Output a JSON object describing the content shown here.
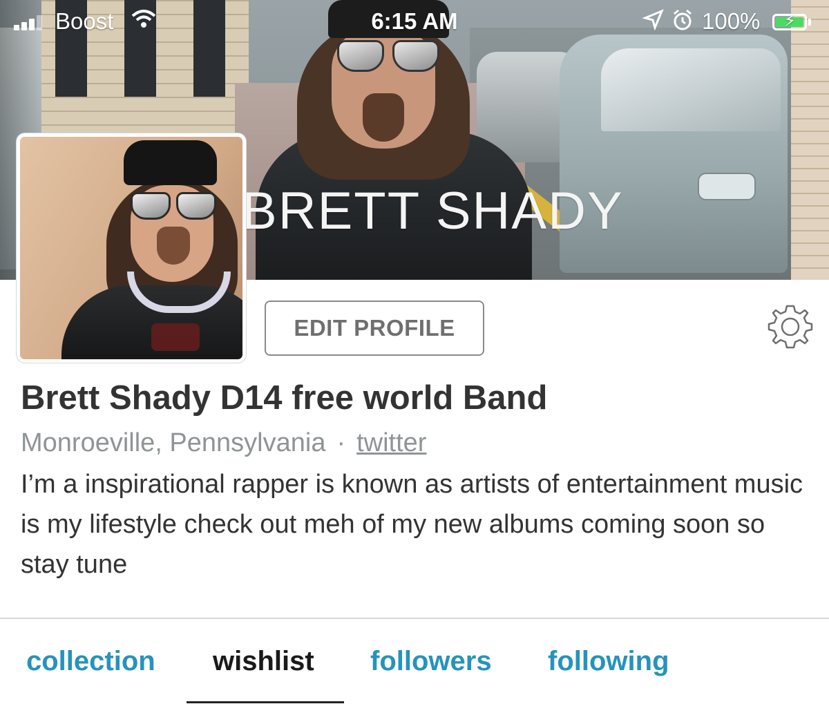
{
  "status_bar": {
    "carrier": "Boost",
    "time": "6:15 AM",
    "battery_percent": "100%",
    "battery_color": "#4cd964"
  },
  "header": {
    "banner_text": "BRETT SHADY"
  },
  "profile": {
    "edit_button_label": "EDIT PROFILE",
    "name": "Brett Shady D14 free world Band",
    "location": "Monroeville, Pennsylvania",
    "separator": "·",
    "link_label": "twitter",
    "bio": "I’m a inspirational rapper is known as artists of entertainment music is my lifestyle check out meh of my new albums coming soon so stay tune"
  },
  "tabs": [
    {
      "label": "collection",
      "active": false
    },
    {
      "label": "wishlist",
      "active": true
    },
    {
      "label": "followers",
      "active": false
    },
    {
      "label": "following",
      "active": false
    }
  ],
  "colors": {
    "tab_accent": "#2593bd",
    "active_tab": "#1a1a1a",
    "name_text": "#333333",
    "meta_text": "#8f9496"
  },
  "icons": [
    "signal-icon",
    "wifi-icon",
    "location-arrow-icon",
    "alarm-clock-icon",
    "battery-charging-icon",
    "gear-icon"
  ]
}
